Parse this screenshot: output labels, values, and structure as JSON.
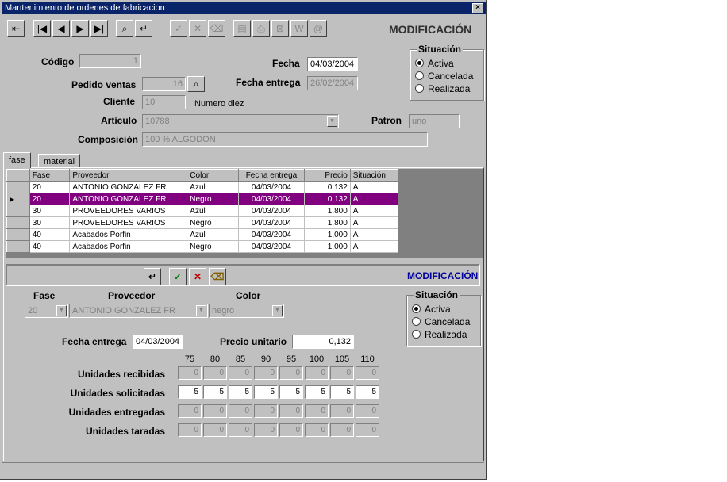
{
  "window": {
    "title": "Mantenimiento de ordenes de fabricacion",
    "close_glyph": "×",
    "mode_label": "MODIFICACIÓN"
  },
  "toolbar": {
    "buttons": [
      {
        "name": "exit-button",
        "glyph": "⇤"
      },
      {
        "name": "first-button",
        "glyph": "|◀"
      },
      {
        "name": "prev-button",
        "glyph": "◀"
      },
      {
        "name": "next-button",
        "glyph": "▶"
      },
      {
        "name": "last-button",
        "glyph": "▶|"
      },
      {
        "name": "binoculars-button",
        "glyph": "⌕"
      },
      {
        "name": "return-button",
        "glyph": "↵"
      },
      {
        "name": "accept-button",
        "glyph": "✓"
      },
      {
        "name": "cancel-button",
        "glyph": "✕"
      },
      {
        "name": "erase-button",
        "glyph": "⌫"
      },
      {
        "name": "preview-button",
        "glyph": "▤"
      },
      {
        "name": "print-button",
        "glyph": "⎙"
      },
      {
        "name": "excel-button",
        "glyph": "⊠"
      },
      {
        "name": "word-button",
        "glyph": "W"
      },
      {
        "name": "email-button",
        "glyph": "@"
      }
    ]
  },
  "header": {
    "codigo_label": "Código",
    "codigo_value": "1",
    "fecha_label": "Fecha",
    "fecha_value": "04/03/2004",
    "pedido_label": "Pedido ventas",
    "pedido_value": "16",
    "fecha_entrega_label": "Fecha entrega",
    "fecha_entrega_value": "26/02/2004",
    "cliente_label": "Cliente",
    "cliente_value": "10",
    "cliente_name": "Numero diez",
    "articulo_label": "Artículo",
    "articulo_value": "10788",
    "patron_label": "Patron",
    "patron_value": "uno",
    "composicion_label": "Composición",
    "composicion_value": "100 % ALGODON"
  },
  "situacion": {
    "title": "Situación",
    "options": [
      "Activa",
      "Cancelada",
      "Realizada"
    ],
    "selected": "Activa"
  },
  "tabs": [
    {
      "label": "fase"
    },
    {
      "label": "material"
    }
  ],
  "grid": {
    "columns": [
      "Fase",
      "Proveedor",
      "Color",
      "Fecha entrega",
      "Precio",
      "Situación"
    ],
    "rows": [
      {
        "fase": "20",
        "proveedor": "ANTONIO GONZALEZ FR",
        "color": "Azul",
        "fecha": "04/03/2004",
        "precio": "0,132",
        "situacion": "A"
      },
      {
        "fase": "20",
        "proveedor": "ANTONIO GONZALEZ FR",
        "color": "Negro",
        "fecha": "04/03/2004",
        "precio": "0,132",
        "situacion": "A"
      },
      {
        "fase": "30",
        "proveedor": "PROVEEDORES VARIOS",
        "color": "Azul",
        "fecha": "04/03/2004",
        "precio": "1,800",
        "situacion": "A"
      },
      {
        "fase": "30",
        "proveedor": "PROVEEDORES VARIOS",
        "color": "Negro",
        "fecha": "04/03/2004",
        "precio": "1,800",
        "situacion": "A"
      },
      {
        "fase": "40",
        "proveedor": "Acabados Porfin",
        "color": "Azul",
        "fecha": "04/03/2004",
        "precio": "1,000",
        "situacion": "A"
      },
      {
        "fase": "40",
        "proveedor": "Acabados Porfin",
        "color": "Negro",
        "fecha": "04/03/2004",
        "precio": "1,000",
        "situacion": "A"
      }
    ],
    "selected_row": 1,
    "row_indicator": "▶"
  },
  "detail": {
    "mode_label": "MODIFICACIÓN",
    "buttons": [
      {
        "name": "detail-return-button",
        "glyph": "↵"
      },
      {
        "name": "detail-accept-button",
        "glyph": "✓"
      },
      {
        "name": "detail-cancel-button",
        "glyph": "✕"
      },
      {
        "name": "detail-erase-button",
        "glyph": "⌫"
      }
    ],
    "fase_label": "Fase",
    "fase_value": "20",
    "proveedor_label": "Proveedor",
    "proveedor_value": "ANTONIO GONZALEZ FR",
    "color_label": "Color",
    "color_value": "negro",
    "fecha_entrega_label": "Fecha entrega",
    "fecha_entrega_value": "04/03/2004",
    "precio_label": "Precio unitario",
    "precio_value": "0,132",
    "situacion_title": "Situación",
    "situacion_options": [
      "Activa",
      "Cancelada",
      "Realizada"
    ],
    "situacion_selected": "Activa",
    "sizes": [
      "75",
      "80",
      "85",
      "90",
      "95",
      "100",
      "105",
      "110"
    ],
    "unit_rows": [
      {
        "label": "Unidades recibidas",
        "values": [
          "0",
          "0",
          "0",
          "0",
          "0",
          "0",
          "0",
          "0"
        ],
        "editable": false
      },
      {
        "label": "Unidades solicitadas",
        "values": [
          "5",
          "5",
          "5",
          "5",
          "5",
          "5",
          "5",
          "5"
        ],
        "editable": true
      },
      {
        "label": "Unidades entregadas",
        "values": [
          "0",
          "0",
          "0",
          "0",
          "0",
          "0",
          "0",
          "0"
        ],
        "editable": false
      },
      {
        "label": "Unidades taradas",
        "values": [
          "0",
          "0",
          "0",
          "0",
          "0",
          "0",
          "0",
          "0"
        ],
        "editable": false
      }
    ]
  },
  "colors": {
    "title_bar": "#0a246a",
    "selected_row": "#800080",
    "detail_mode": "#0000a0",
    "accept_green": "#008000",
    "cancel_red": "#c00000"
  }
}
